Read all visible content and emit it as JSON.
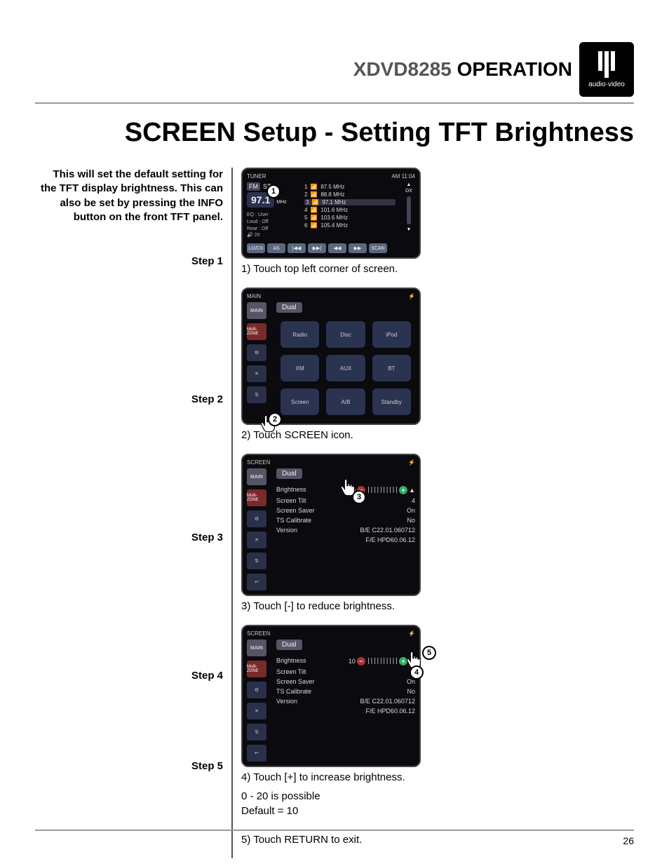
{
  "header": {
    "model": "XDVD8285",
    "operation": "OPERATION",
    "logo_sub": "audio·video"
  },
  "title": "SCREEN Setup - Setting TFT Brightness",
  "intro": "This will set the default setting for the TFT display brightness. This can also be set by pressing the INFO button on the front TFT panel.",
  "steps": {
    "s1": {
      "label": "Step 1",
      "caption": "1) Touch top left corner of screen."
    },
    "s2": {
      "label": "Step 2",
      "caption": "2) Touch SCREEN icon."
    },
    "s3": {
      "label": "Step 3",
      "caption": "3) Touch [-] to reduce brightness."
    },
    "s4": {
      "label": "Step 4",
      "caption": "4) Touch [+] to increase brightness.",
      "range": "0 - 20 is possible",
      "default": "Default = 10"
    },
    "s5": {
      "label": "Step 5",
      "caption": "5) Touch RETURN to exit."
    }
  },
  "radio": {
    "top_left": "TUNER",
    "time": "AM 11:04",
    "band": "FM",
    "st": "ST",
    "freq": "97.1",
    "unit": "MHz",
    "dx": "DX",
    "eq": "EQ   : User",
    "loud": "Loud : Off",
    "rear": "Rear : Off",
    "vol": "20",
    "presets": [
      {
        "n": "1",
        "f": "87.5 MHz"
      },
      {
        "n": "2",
        "f": "88.8 MHz"
      },
      {
        "n": "3",
        "f": "97.1 MHz"
      },
      {
        "n": "4",
        "f": "101.6 MHz"
      },
      {
        "n": "5",
        "f": "103.6 MHz"
      },
      {
        "n": "6",
        "f": "105.4 MHz"
      }
    ],
    "btns": [
      "LO/DX",
      "AS",
      "|◀◀",
      "▶▶|",
      "◀◀",
      "▶▶",
      "SCAN"
    ]
  },
  "menu": {
    "header": "MAIN",
    "brand": "Dual",
    "side": [
      "MAIN",
      "Multi-ZONE",
      "⚙",
      "✕",
      "⇅",
      "↩"
    ],
    "icons": [
      "Radio",
      "Disc",
      "iPod",
      "XM",
      "AUX",
      "BT",
      "Screen",
      "A/B",
      "Standby"
    ]
  },
  "screen_menu": {
    "header": "SCREEN",
    "brand": "Dual",
    "side": [
      "MAIN",
      "Multi-ZONE",
      "⚙",
      "✕",
      "⇅",
      "↩"
    ],
    "rows": {
      "brightness_label": "Brightness",
      "brightness_val": "10",
      "tilt_label": "Screen Tilt",
      "tilt_val": "4",
      "saver_label": "Screen Saver",
      "saver_val": "On",
      "ts_label": "TS Calibrate",
      "ts_val": "No",
      "ver_label": "Version",
      "ver_be": "B/E  C22.01.060712",
      "ver_fe": "F/E  HPD60.06.12"
    }
  },
  "page": "26"
}
